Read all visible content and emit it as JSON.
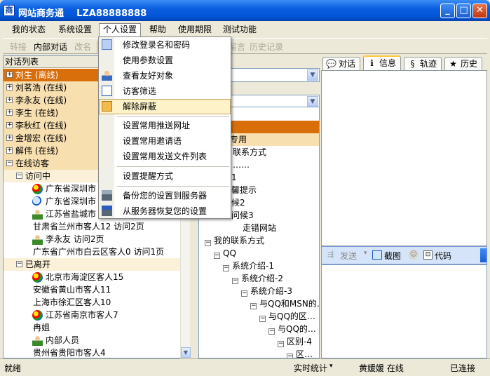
{
  "window": {
    "app_name": "网站商务通",
    "account": "LZA88888888"
  },
  "menubar": {
    "items": [
      "我的状态",
      "系统设置",
      "个人设置",
      "帮助",
      "使用期限",
      "测试功能"
    ]
  },
  "toolbar": {
    "items": [
      "转接",
      "内部对话",
      "改名",
      "留言",
      "历史记录"
    ]
  },
  "left_panel": {
    "header": "对话列表",
    "contacts": [
      {
        "name": "刘生 (离线)",
        "selected": true
      },
      {
        "name": "刘茗浩 (在线)"
      },
      {
        "name": "李永友 (在线)"
      },
      {
        "name": "李生 (在线)"
      },
      {
        "name": "李秋红 (在线)"
      },
      {
        "name": "金增宏 (在线)"
      },
      {
        "name": "解伟 (在线)"
      }
    ],
    "visitors_group": "在线访客",
    "visiting_group": "访问中",
    "visiting": [
      {
        "icon": "globe-icon",
        "text": "广东省深圳市"
      },
      {
        "icon": "search-icon",
        "text": "广东省深圳市"
      },
      {
        "icon": "person-icon",
        "text": "江苏省盐城市"
      },
      {
        "icon": "",
        "text": "甘肃省兰州市客人12 访问2页"
      },
      {
        "icon": "person-icon",
        "text": "李永友 访问2页"
      },
      {
        "icon": "",
        "text": "广东省广州市白云区客人0 访问1页"
      }
    ],
    "left_group": "已离开",
    "left": [
      {
        "icon": "globe-icon",
        "text": "北京市海淀区客人15"
      },
      {
        "icon": "",
        "text": "安徽省黄山市客人11"
      },
      {
        "icon": "",
        "text": "上海市徐汇区客人10"
      },
      {
        "icon": "globe-icon",
        "text": "江苏省南京市客人7"
      },
      {
        "icon": "",
        "text": "冉姐"
      },
      {
        "icon": "person-icon",
        "text": "内部人员"
      },
      {
        "icon": "",
        "text": "贵州省贵阳市客人4"
      }
    ]
  },
  "middle_panel": {
    "list_header": "列表",
    "tree_partial": [
      "专用",
      "联系方式",
      "……",
      "1",
      "馨提示",
      "候2",
      "问候3",
      "走错网站"
    ],
    "tree": [
      {
        "text": "我的联系方式",
        "depth": 0
      },
      {
        "text": "QQ",
        "depth": 1
      },
      {
        "text": "系统介绍-1",
        "depth": 2
      },
      {
        "text": "系统介绍-2",
        "depth": 3
      },
      {
        "text": "系统介绍-3",
        "depth": 4
      },
      {
        "text": "与QQ和MSN的…",
        "depth": 5
      },
      {
        "text": "与QQ的区…",
        "depth": 6
      },
      {
        "text": "与QQ的…",
        "depth": 7
      },
      {
        "text": "区别-4",
        "depth": 8
      },
      {
        "text": "区…",
        "depth": 9
      }
    ]
  },
  "tabs": [
    "对话",
    "信息",
    "轨迹",
    "历史"
  ],
  "send_bar": {
    "send": "发送",
    "screenshot": "截图",
    "code": "代码"
  },
  "statusbar": {
    "ready": "就绪",
    "stats": "实时统计",
    "user": "黄媛媛 在线",
    "connection": "已连接"
  },
  "popup_menu": {
    "items": [
      "修改登录名和密码",
      "使用参数设置",
      "查看友好对象",
      "访客筛选",
      "解除屏蔽",
      "设置常用推送网址",
      "设置常用邀请语",
      "设置常用发送文件列表",
      "设置提醒方式",
      "备份您的设置到服务器",
      "从服务器恢复您的设置"
    ]
  },
  "colors": {
    "title_blue": "#0355d6",
    "selection_orange": "#d86f0a",
    "highlight_beige": "#f7dfb0",
    "menu_hover": "#fdf2c8"
  }
}
